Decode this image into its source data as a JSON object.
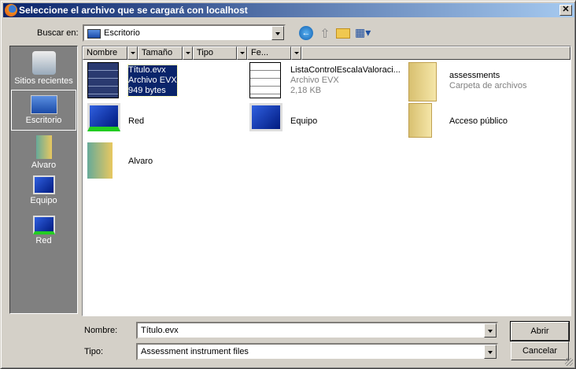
{
  "title": "Seleccione el archivo que se cargará con localhost",
  "look_in": {
    "label": "Buscar en:",
    "value": "Escritorio"
  },
  "toolbar": {
    "icons": [
      "back-icon",
      "up-folder-icon",
      "new-folder-icon",
      "view-menu-icon"
    ]
  },
  "sidebar": {
    "items": [
      {
        "label": "Sitios recientes"
      },
      {
        "label": "Escritorio",
        "selected": true
      },
      {
        "label": "Alvaro"
      },
      {
        "label": "Equipo"
      },
      {
        "label": "Red"
      }
    ]
  },
  "columns": [
    "Nombre",
    "Tamaño",
    "Tipo",
    "Fe..."
  ],
  "files": [
    {
      "name": "Título.evx",
      "type": "Archivo EVX",
      "size": "949 bytes",
      "selected": true
    },
    {
      "name": "ListaControlEscalaValoraci...",
      "type": "Archivo EVX",
      "size": "2,18 KB"
    },
    {
      "name": "assessments",
      "type": "Carpeta de archivos"
    },
    {
      "name": "Red"
    },
    {
      "name": "Equipo"
    },
    {
      "name": "Acceso público"
    },
    {
      "name": "Alvaro"
    }
  ],
  "filename": {
    "label": "Nombre:",
    "value": "Título.evx"
  },
  "filetype": {
    "label": "Tipo:",
    "value": "Assessment instrument files"
  },
  "buttons": {
    "open": "Abrir",
    "cancel": "Cancelar"
  }
}
